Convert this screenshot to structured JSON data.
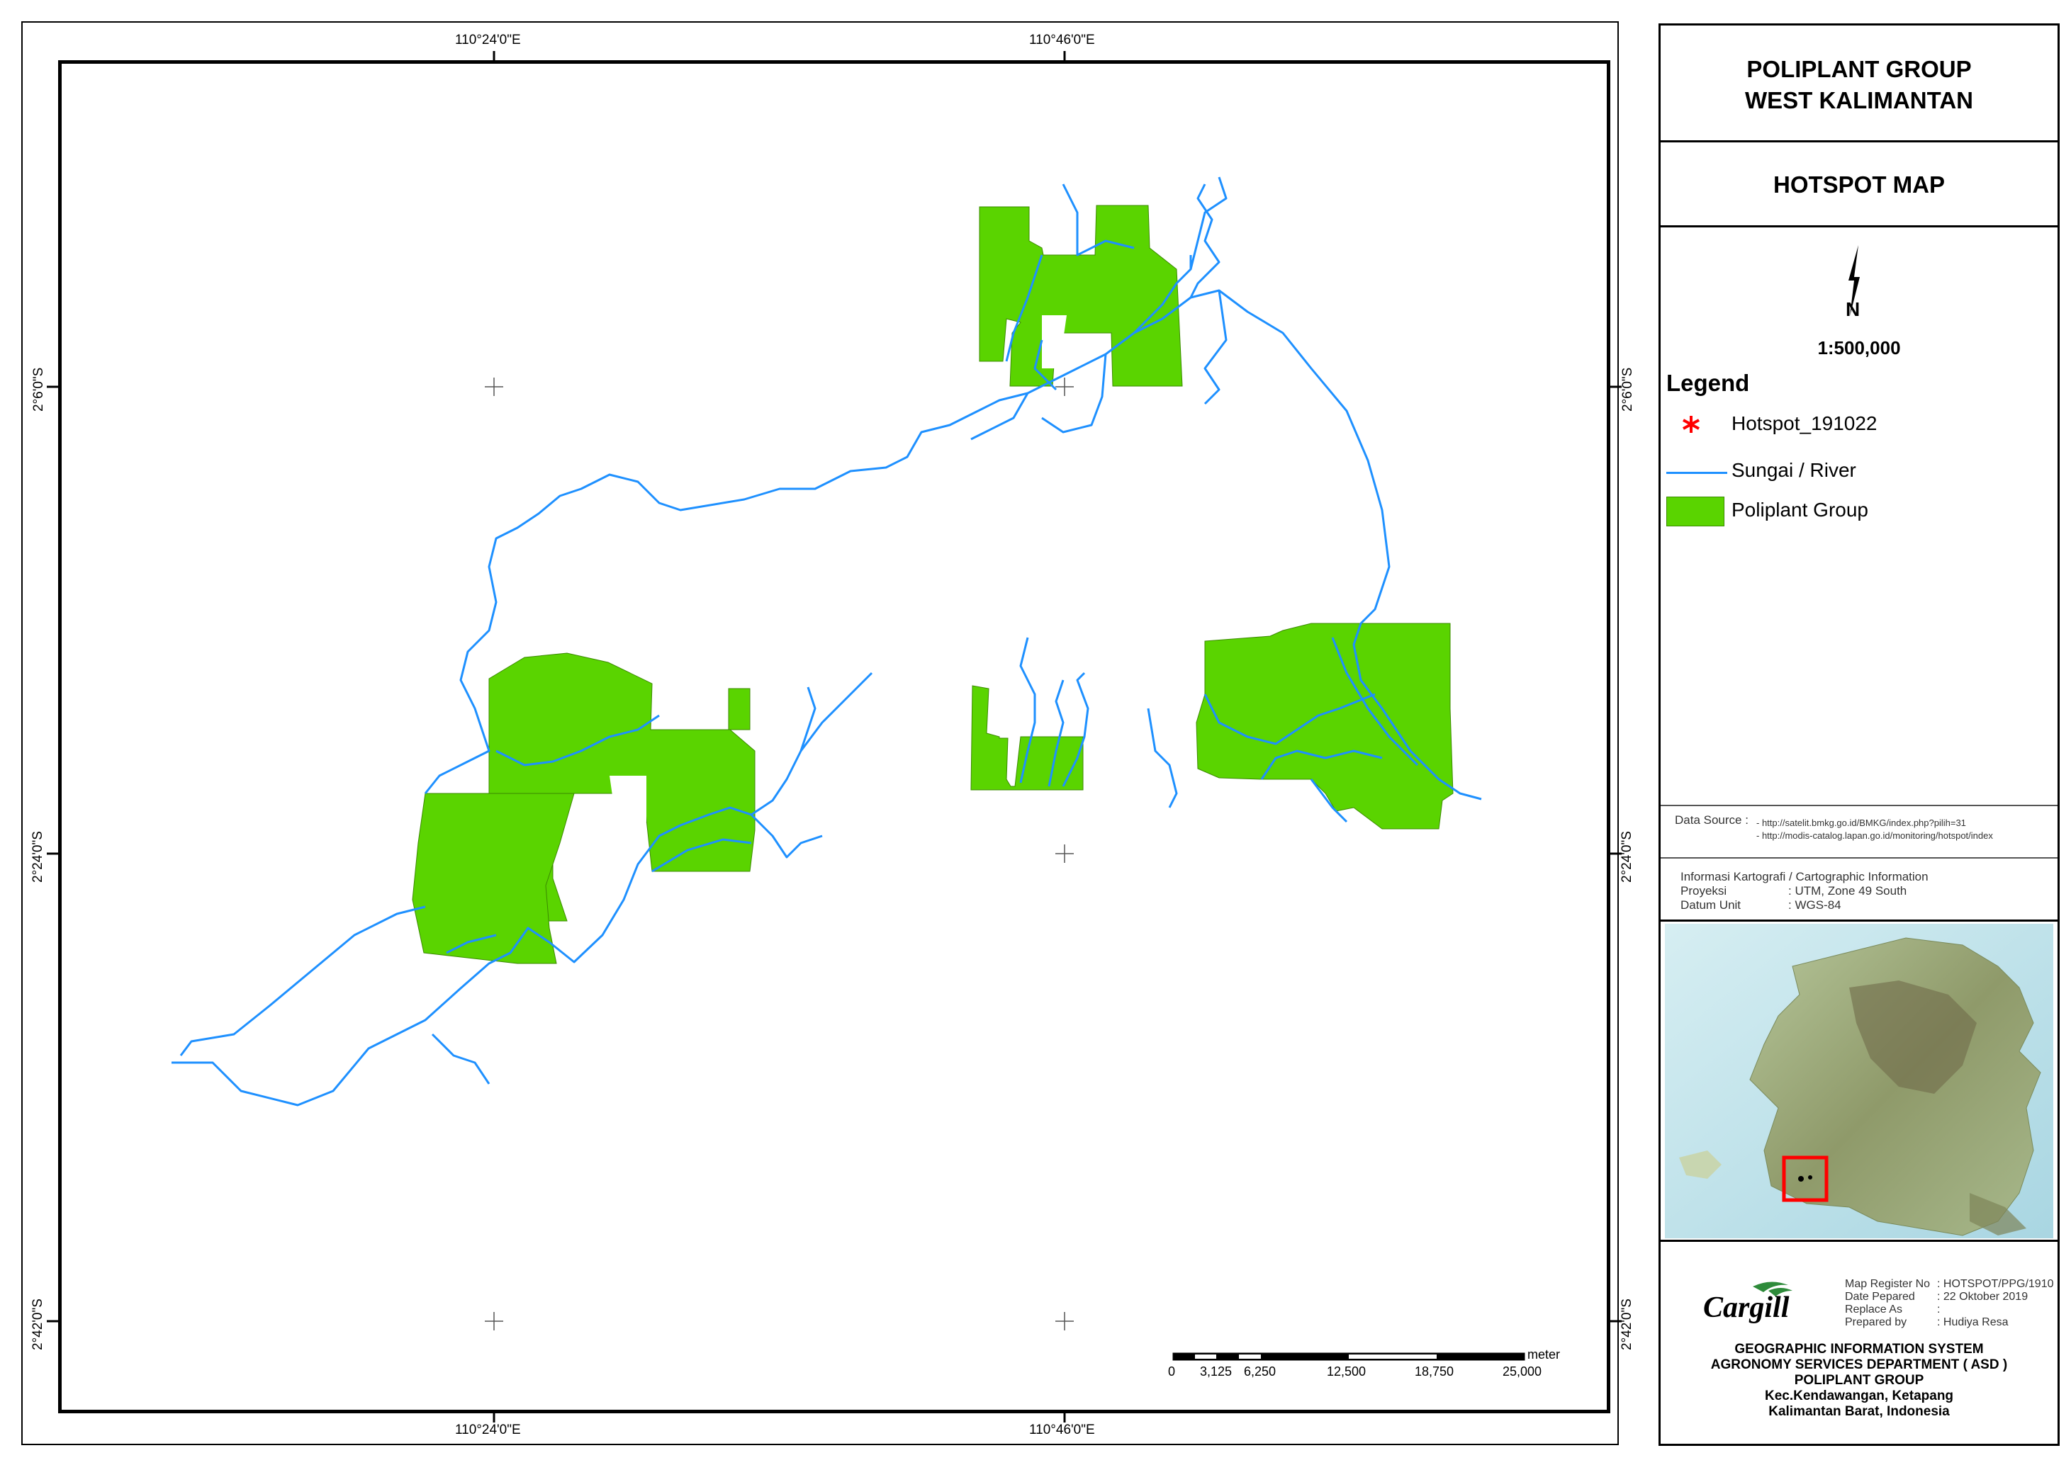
{
  "map": {
    "coords_top": [
      "110°24'0\"E",
      "110°46'0\"E"
    ],
    "coords_bottom": [
      "110°24'0\"E",
      "110°46'0\"E"
    ],
    "coords_left": [
      "2°6'0\"S",
      "2°24'0\"S",
      "2°42'0\"S"
    ],
    "coords_right": [
      "2°6'0\"S",
      "2°24'0\"S",
      "2°42'0\"S"
    ],
    "scale_unit": "meter",
    "scale_ticks": [
      "0",
      "3,125",
      "6,250",
      "12,500",
      "18,750",
      "25,000"
    ],
    "colors": {
      "river": "#1e90ff",
      "plantation": "#5ad400",
      "hotspot": "#ff0000"
    }
  },
  "panel": {
    "title_line1": "POLIPLANT GROUP",
    "title_line2": "WEST KALIMANTAN",
    "subtitle": "HOTSPOT MAP",
    "north_letter": "N",
    "scale_ratio": "1:500,000",
    "legend_title": "Legend",
    "legend_items": [
      {
        "label": "Hotspot_191022",
        "icon": "asterisk-icon"
      },
      {
        "label": "Sungai / River",
        "icon": "line-icon"
      },
      {
        "label": "Poliplant Group",
        "icon": "fill-box-icon"
      }
    ],
    "data_source_label": "Data Source :",
    "data_sources": [
      "- http://satelit.bmkg.go.id/BMKG/index.php?pilih=31",
      "- http://modis-catalog.lapan.go.id/monitoring/hotspot/index"
    ],
    "carto_title": "Informasi Kartografi / Cartographic Information",
    "carto_rows": [
      {
        "k": "Proyeksi",
        "v": ": UTM, Zone 49 South"
      },
      {
        "k": "Datum Unit",
        "v": ": WGS-84"
      }
    ],
    "logo_text": "Cargill",
    "register_rows": [
      {
        "k": "Map Register No",
        "v": ": HOTSPOT/PPG/1910"
      },
      {
        "k": "Date Pepared",
        "v": ": 22 Oktober 2019"
      },
      {
        "k": "Replace As",
        "v": ":"
      },
      {
        "k": "Prepared by",
        "v": ": Hudiya Resa"
      }
    ],
    "footer_lines": [
      "GEOGRAPHIC INFORMATION SYSTEM",
      "AGRONOMY SERVICES DEPARTMENT ( ASD )",
      "POLIPLANT GROUP",
      "Kec.Kendawangan, Ketapang",
      "Kalimantan Barat, Indonesia"
    ]
  }
}
